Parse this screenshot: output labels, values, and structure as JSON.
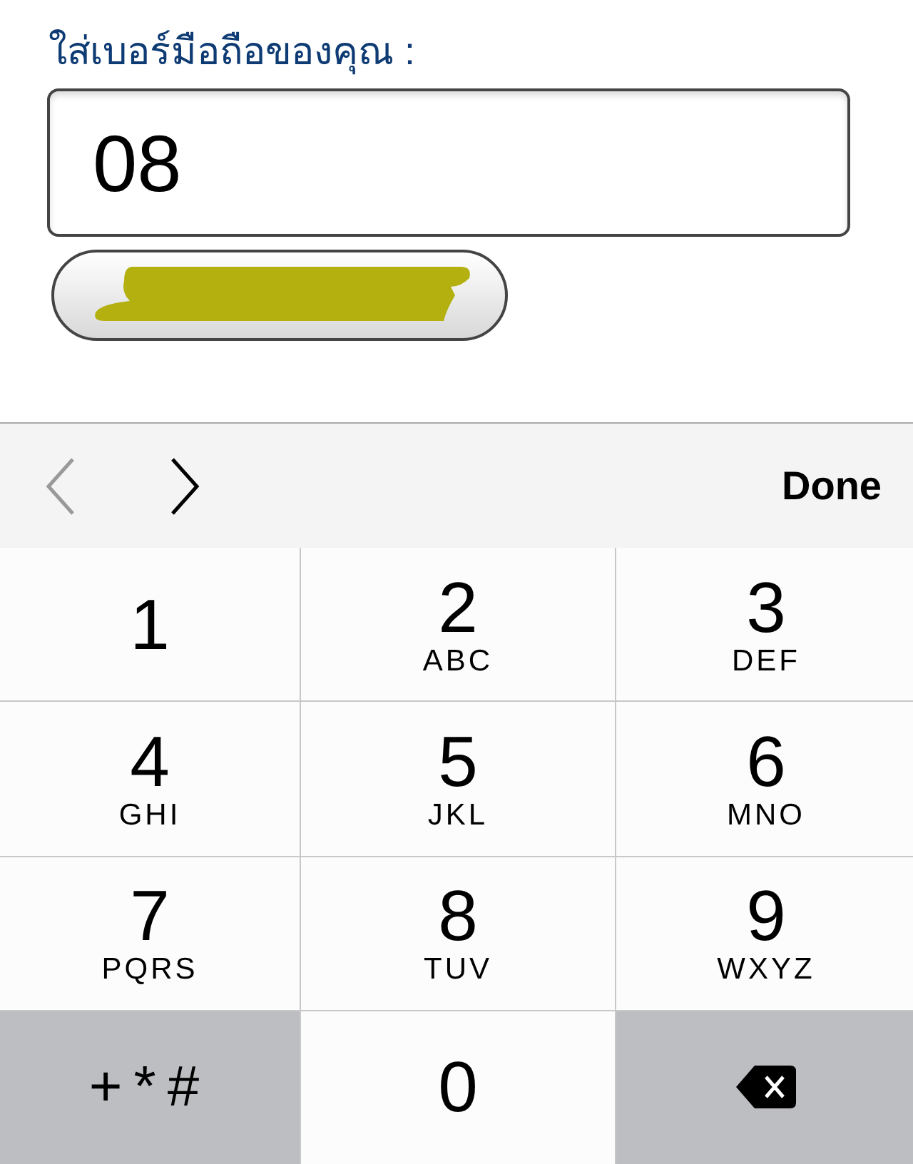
{
  "form": {
    "label": "ใส่เบอร์มือถือของคุณ :",
    "phone_field": {
      "value": "08"
    },
    "submit_button": {
      "redacted": true
    }
  },
  "keyboard_toolbar": {
    "previous": {
      "disabled": true
    },
    "next": {
      "disabled": false
    },
    "done": "Done"
  },
  "keys": [
    {
      "kind": "digit",
      "digit": "1"
    },
    {
      "kind": "digit",
      "digit": "2",
      "letters": "ABC"
    },
    {
      "kind": "digit",
      "digit": "3",
      "letters": "DEF"
    },
    {
      "kind": "digit",
      "digit": "4",
      "letters": "GHI"
    },
    {
      "kind": "digit",
      "digit": "5",
      "letters": "JKL"
    },
    {
      "kind": "digit",
      "digit": "6",
      "letters": "MNO"
    },
    {
      "kind": "digit",
      "digit": "7",
      "letters": "PQRS"
    },
    {
      "kind": "digit",
      "digit": "8",
      "letters": "TUV"
    },
    {
      "kind": "digit",
      "digit": "9",
      "letters": "WXYZ"
    },
    {
      "kind": "symbols",
      "label": "+*#"
    },
    {
      "kind": "digit",
      "digit": "0"
    },
    {
      "kind": "delete"
    }
  ]
}
